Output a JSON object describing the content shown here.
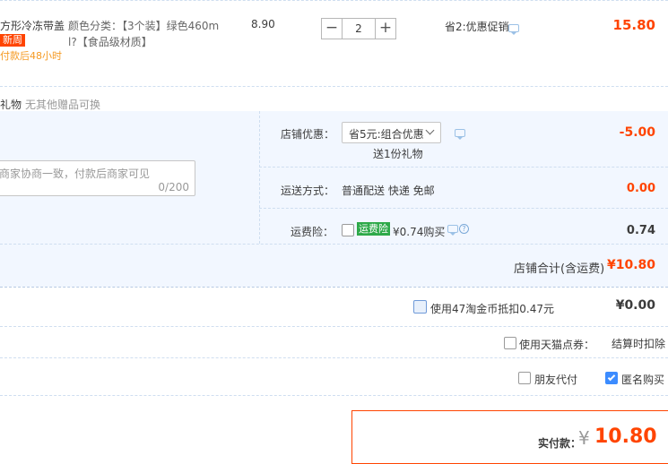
{
  "item": {
    "title": "方形冷冻带盖...",
    "badge": "新周",
    "shipping_note": "付款后48小时",
    "sku_line1": "颜色分类：【3个装】绿色460m",
    "sku_line2": "l?【食品级材质】",
    "unit_price": "8.90",
    "qty_minus": "−",
    "quantity": "2",
    "qty_plus": "+",
    "promo": "省2:优惠促销",
    "subtotal": "15.80"
  },
  "gift_note": {
    "label": "礼物",
    "text": "无其他赠品可换"
  },
  "message": {
    "placeholder": "商家协商一致，付款后商家可见",
    "counter": "0/200"
  },
  "shop_discount": {
    "label": "店铺优惠：",
    "select_value": "省5元:组合优惠",
    "gift": "送1份礼物",
    "amount": "-5.00"
  },
  "delivery": {
    "label": "运送方式：",
    "value": "普通配送 快递 免邮",
    "amount": "0.00"
  },
  "insurance": {
    "label": "运费险：",
    "badge": "运费险",
    "text": "¥0.74购买",
    "amount": "0.74"
  },
  "shop_total": {
    "label": "店铺合计(含运费)",
    "amount": "¥10.80"
  },
  "coins": {
    "label": "使用47淘金币抵扣0.47元",
    "amount": "¥0.00"
  },
  "coupon": {
    "label": "使用天猫点券：",
    "value": "结算时扣除"
  },
  "options": {
    "friend_pay": "朋友代付",
    "anonymous": "匿名购买"
  },
  "payment": {
    "label": "实付款：",
    "currency": "¥",
    "amount": "10.80"
  },
  "colors": {
    "price_red": "#ff4400",
    "panel_blue": "#f2f7ff",
    "checkbox_blue": "#3c8cff"
  }
}
